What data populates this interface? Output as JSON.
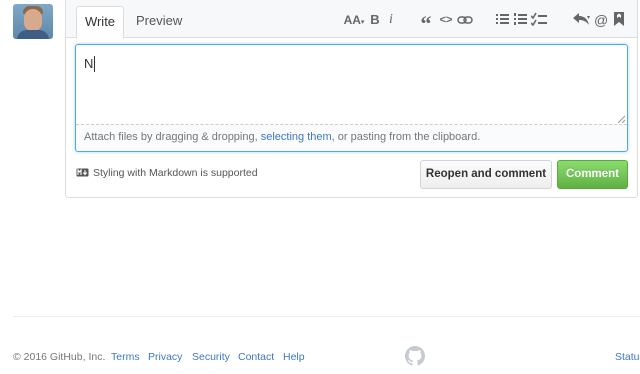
{
  "avatar": {
    "alt": "user avatar"
  },
  "tabs": [
    {
      "label": "Write",
      "active": true
    },
    {
      "label": "Preview",
      "active": false
    }
  ],
  "toolbar": {
    "icons": [
      "text-size-icon",
      "bold-icon",
      "italic-icon",
      "quote-icon",
      "code-icon",
      "link-icon",
      "unordered-list-icon",
      "ordered-list-icon",
      "task-list-icon",
      "reply-icon",
      "mention-icon",
      "bookmark-icon"
    ],
    "text_size_label": "AA",
    "bold_label": "B",
    "italic_label": "i",
    "quote_label": "“",
    "code_label": "<>",
    "mention_label": "@"
  },
  "editor": {
    "value": "N",
    "drop_text_before": "Attach files by dragging & dropping, ",
    "drop_link": "selecting them",
    "drop_text_after": ", or pasting from the clipboard."
  },
  "markdown_note": "Styling with Markdown is supported",
  "buttons": {
    "reopen": "Reopen and comment",
    "comment": "Comment"
  },
  "footer": {
    "copyright": "© 2016 GitHub, Inc.",
    "links": [
      "Terms",
      "Privacy",
      "Security",
      "Contact",
      "Help"
    ],
    "right_link": "Status"
  },
  "colors": {
    "accent_link": "#4078c0",
    "comment_green": "#6cc644",
    "focus_border": "#51a7e8"
  }
}
